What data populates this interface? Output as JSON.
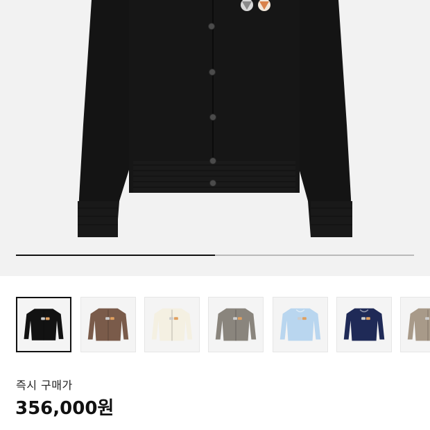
{
  "product": {
    "gallery": {
      "progress": 0.5,
      "colors": {
        "background": "#f2f2f2",
        "garment": "#121212",
        "progress_active": "#111111",
        "progress_track": "#b9b9b9"
      }
    },
    "thumbnails": [
      {
        "color": "#121212",
        "selected": true,
        "cut": "crew",
        "icon": "cardigan-icon"
      },
      {
        "color": "#7a5b4a",
        "selected": false,
        "cut": "crew",
        "icon": "cardigan-icon"
      },
      {
        "color": "#f4f0e2",
        "selected": false,
        "cut": "crew",
        "icon": "cardigan-icon"
      },
      {
        "color": "#8a857d",
        "selected": false,
        "cut": "crew",
        "icon": "cardigan-icon"
      },
      {
        "color": "#b9d6ef",
        "selected": false,
        "cut": "sweater",
        "icon": "sweater-icon"
      },
      {
        "color": "#1f2a57",
        "selected": false,
        "cut": "sweater",
        "icon": "sweater-icon"
      },
      {
        "color": "#a89a89",
        "selected": false,
        "cut": "crew",
        "icon": "cardigan-icon"
      }
    ],
    "purchase_label": "즉시 구매가",
    "price": "356,000원"
  }
}
